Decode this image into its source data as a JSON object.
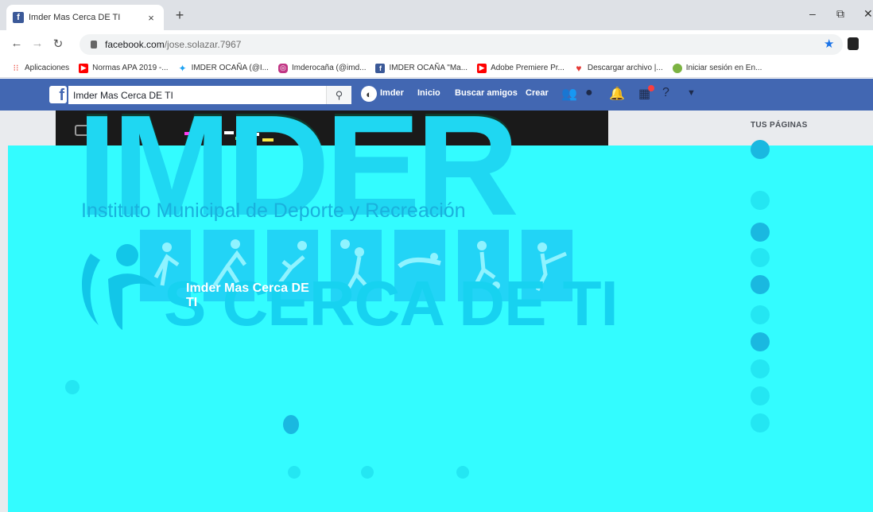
{
  "browser": {
    "tab_title": "Imder Mas Cerca DE TI",
    "tab_close": "×",
    "new_tab": "+",
    "url_host": "facebook.com",
    "url_path": "/jose.solazar.7967",
    "minimize": "–",
    "restore": "⧉",
    "close": "✕"
  },
  "bookmarks": [
    {
      "label": "Aplicaciones",
      "icon": "apps-grid-icon",
      "color": "#e94235"
    },
    {
      "label": "Normas APA 2019 -...",
      "icon": "youtube-icon",
      "color": "#ff0000"
    },
    {
      "label": "IMDER OCAÑA (@I...",
      "icon": "twitter-icon",
      "color": "#1da1f2"
    },
    {
      "label": "Imderocaña (@imd...",
      "icon": "instagram-icon",
      "color": "#c13584"
    },
    {
      "label": "IMDER OCAÑA \"Ma...",
      "icon": "facebook-icon",
      "color": "#3b5998"
    },
    {
      "label": "Adobe Premiere Pr...",
      "icon": "youtube-icon",
      "color": "#ff0000"
    },
    {
      "label": "Descargar archivo |...",
      "icon": "heart-icon",
      "color": "#e53935"
    },
    {
      "label": "Iniciar sesión en En...",
      "icon": "leaf-icon",
      "color": "#7cb342"
    }
  ],
  "facebook": {
    "search_value": "Imder Mas Cerca DE TI",
    "profile_name": "Imder",
    "nav_home": "Inicio",
    "nav_find_friends": "Buscar amigos",
    "nav_create": "Crear",
    "brand_color": "#4267b2"
  },
  "cover": {
    "big_word": "IMDER",
    "institute": "Instituto Municipal de Deporte y Recreación",
    "slogan": "S CERCA DE TI",
    "page_name_line1": "Imder Mas Cerca DE",
    "page_name_line2": "TI",
    "overlay_color": "#33fcff"
  },
  "right_column": {
    "heading": "TUS PÁGINAS"
  }
}
